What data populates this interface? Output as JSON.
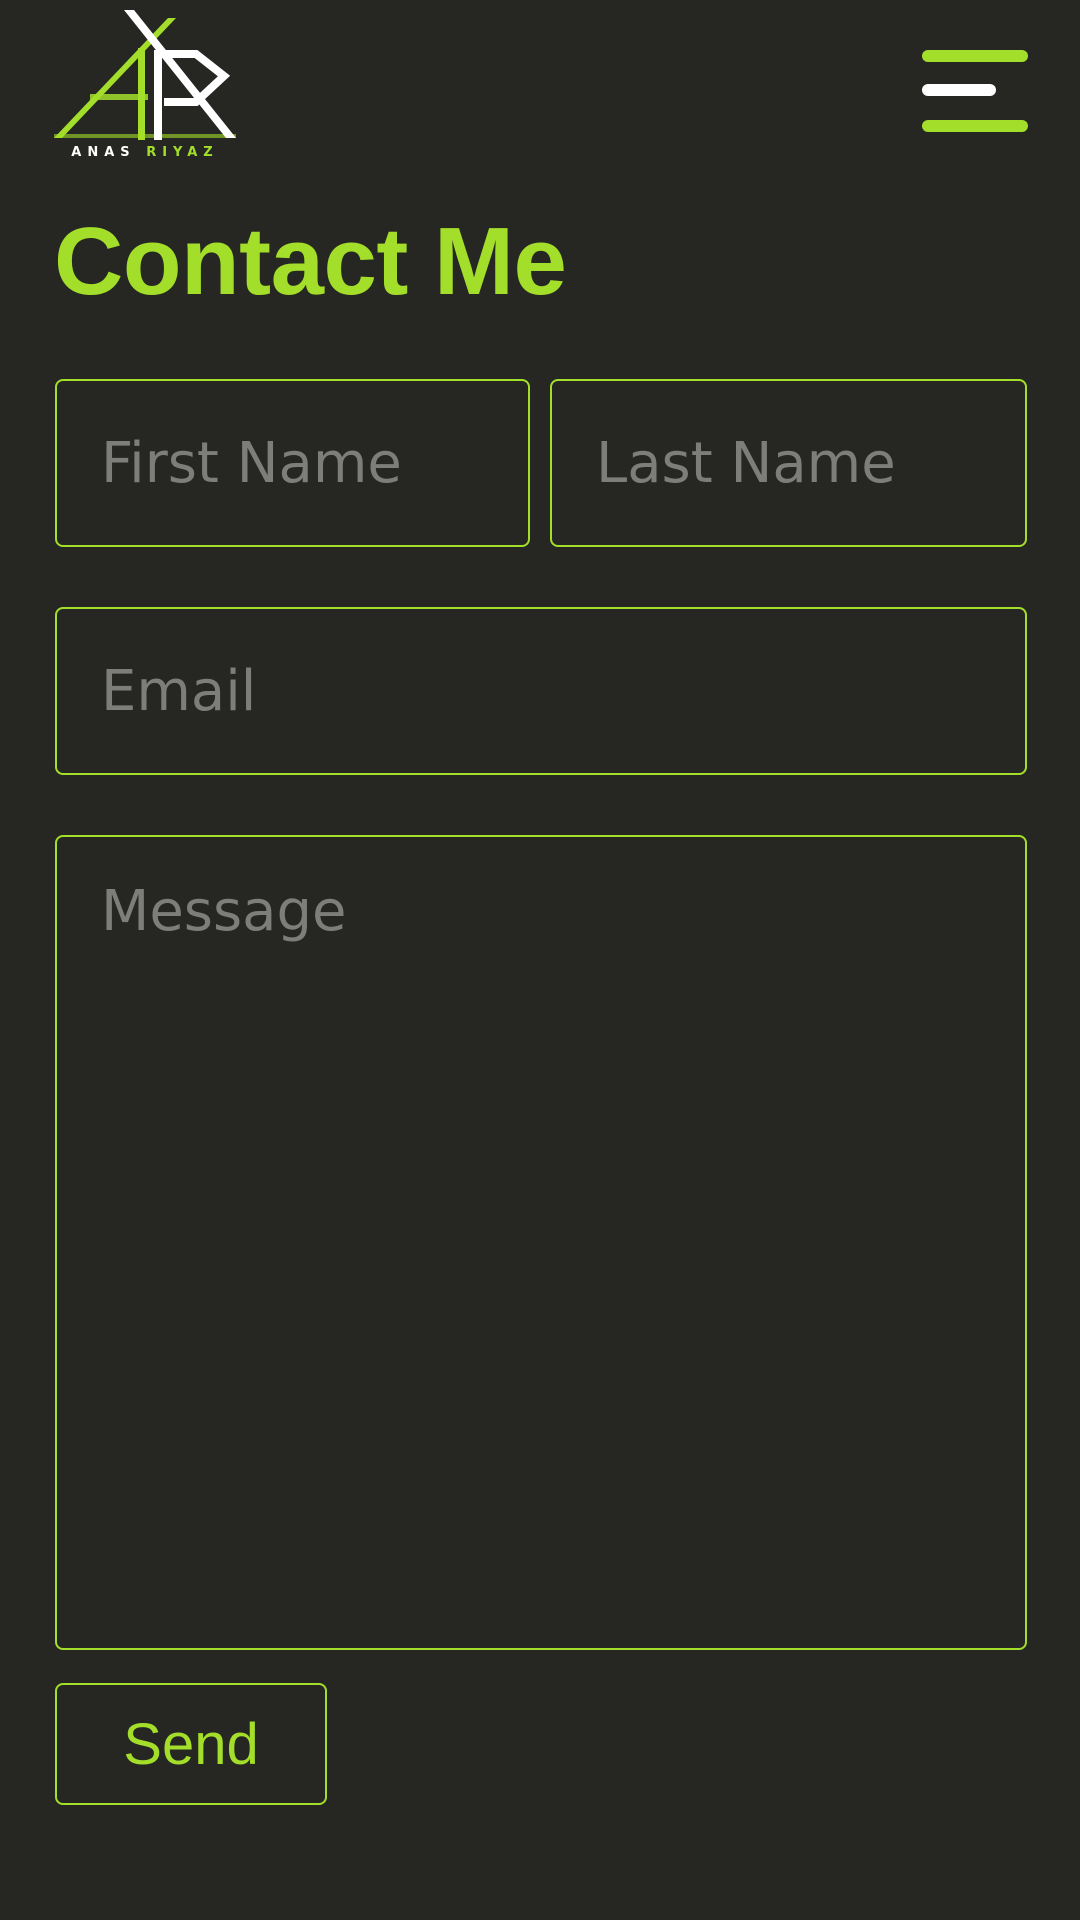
{
  "header": {
    "logo": {
      "first_word": "ANAS",
      "second_word": "RIYAZ"
    },
    "menu_icon": "hamburger-menu-icon"
  },
  "page": {
    "title": "Contact Me"
  },
  "form": {
    "first_name_placeholder": "First Name",
    "last_name_placeholder": "Last Name",
    "email_placeholder": "Email",
    "message_placeholder": "Message",
    "send_label": "Send"
  },
  "colors": {
    "background": "#262722",
    "accent": "#a3de2a",
    "placeholder": "#7d7d7a",
    "white": "#ffffff"
  }
}
